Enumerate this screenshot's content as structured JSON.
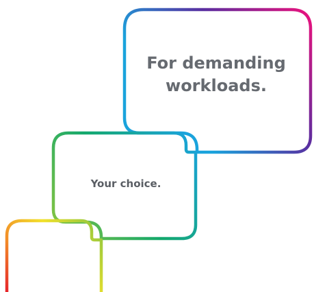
{
  "graphic": {
    "headline_line1": "For demanding",
    "headline_line2": "workloads.",
    "subline": "Your choice."
  },
  "colors": {
    "text": "#666a70",
    "magenta": "#e6137e",
    "purple": "#5a2ea0",
    "blue": "#1aa3dc",
    "green": "#14a86c",
    "lime": "#8cc63f",
    "yellow": "#f2e12c",
    "orange": "#f28c28",
    "red": "#e6252a"
  }
}
